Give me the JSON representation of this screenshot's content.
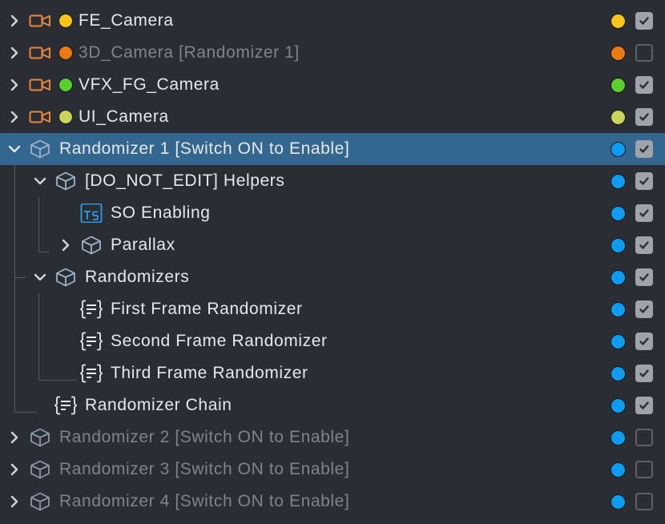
{
  "rows": [
    {
      "label": "FE_Camera",
      "icon": "camera-icon",
      "kind": "camera",
      "dot": "#f5c518",
      "status": "#f5c518",
      "checked": true,
      "expanded": false,
      "dim": false,
      "selected": false,
      "depth": 0
    },
    {
      "label": "3D_Camera [Randomizer 1]",
      "icon": "camera-icon",
      "kind": "camera",
      "dot": "#ec7a12",
      "status": "#ec7a12",
      "checked": false,
      "expanded": false,
      "dim": true,
      "selected": false,
      "depth": 0
    },
    {
      "label": "VFX_FG_Camera",
      "icon": "camera-icon",
      "kind": "camera",
      "dot": "#5ccf2f",
      "status": "#5ccf2f",
      "checked": true,
      "expanded": false,
      "dim": false,
      "selected": false,
      "depth": 0
    },
    {
      "label": "UI_Camera",
      "icon": "camera-icon",
      "kind": "camera",
      "dot": "#c9d45a",
      "status": "#c9d45a",
      "checked": true,
      "expanded": false,
      "dim": false,
      "selected": false,
      "depth": 0
    },
    {
      "label": "Randomizer 1 [Switch ON to Enable]",
      "icon": "cube-icon",
      "kind": "cube",
      "status": "#0e9cf3",
      "checked": true,
      "expanded": true,
      "dim": false,
      "selected": true,
      "depth": 0
    },
    {
      "label": "[DO_NOT_EDIT] Helpers",
      "icon": "cube-icon",
      "kind": "cube",
      "status": "#0e9cf3",
      "checked": true,
      "expanded": true,
      "dim": false,
      "selected": false,
      "depth": 1
    },
    {
      "label": "SO Enabling",
      "icon": "typescript-icon",
      "kind": "ts",
      "status": "#0e9cf3",
      "checked": true,
      "expanded": null,
      "dim": false,
      "selected": false,
      "depth": 2
    },
    {
      "label": "Parallax",
      "icon": "cube-icon",
      "kind": "cube",
      "status": "#0e9cf3",
      "checked": true,
      "expanded": false,
      "dim": false,
      "selected": false,
      "depth": 2
    },
    {
      "label": "Randomizers",
      "icon": "cube-icon",
      "kind": "cube",
      "status": "#0e9cf3",
      "checked": true,
      "expanded": true,
      "dim": false,
      "selected": false,
      "depth": 1
    },
    {
      "label": "First Frame Randomizer",
      "icon": "script-icon",
      "kind": "script",
      "status": "#0e9cf3",
      "checked": true,
      "expanded": null,
      "dim": false,
      "selected": false,
      "depth": 2
    },
    {
      "label": "Second Frame Randomizer",
      "icon": "script-icon",
      "kind": "script",
      "status": "#0e9cf3",
      "checked": true,
      "expanded": null,
      "dim": false,
      "selected": false,
      "depth": 2
    },
    {
      "label": "Third Frame Randomizer",
      "icon": "script-icon",
      "kind": "script",
      "status": "#0e9cf3",
      "checked": true,
      "expanded": null,
      "dim": false,
      "selected": false,
      "depth": 2
    },
    {
      "label": "Randomizer Chain",
      "icon": "script-icon",
      "kind": "script",
      "status": "#0e9cf3",
      "checked": true,
      "expanded": null,
      "dim": false,
      "selected": false,
      "depth": 1
    },
    {
      "label": "Randomizer 2 [Switch ON to Enable]",
      "icon": "cube-icon",
      "kind": "cube",
      "status": "#0e9cf3",
      "checked": false,
      "expanded": false,
      "dim": true,
      "selected": false,
      "depth": 0
    },
    {
      "label": "Randomizer 3 [Switch ON to Enable]",
      "icon": "cube-icon",
      "kind": "cube",
      "status": "#0e9cf3",
      "checked": false,
      "expanded": false,
      "dim": true,
      "selected": false,
      "depth": 0
    },
    {
      "label": "Randomizer 4 [Switch ON to Enable]",
      "icon": "cube-icon",
      "kind": "cube",
      "status": "#0e9cf3",
      "checked": false,
      "expanded": false,
      "dim": true,
      "selected": false,
      "depth": 0
    }
  ]
}
